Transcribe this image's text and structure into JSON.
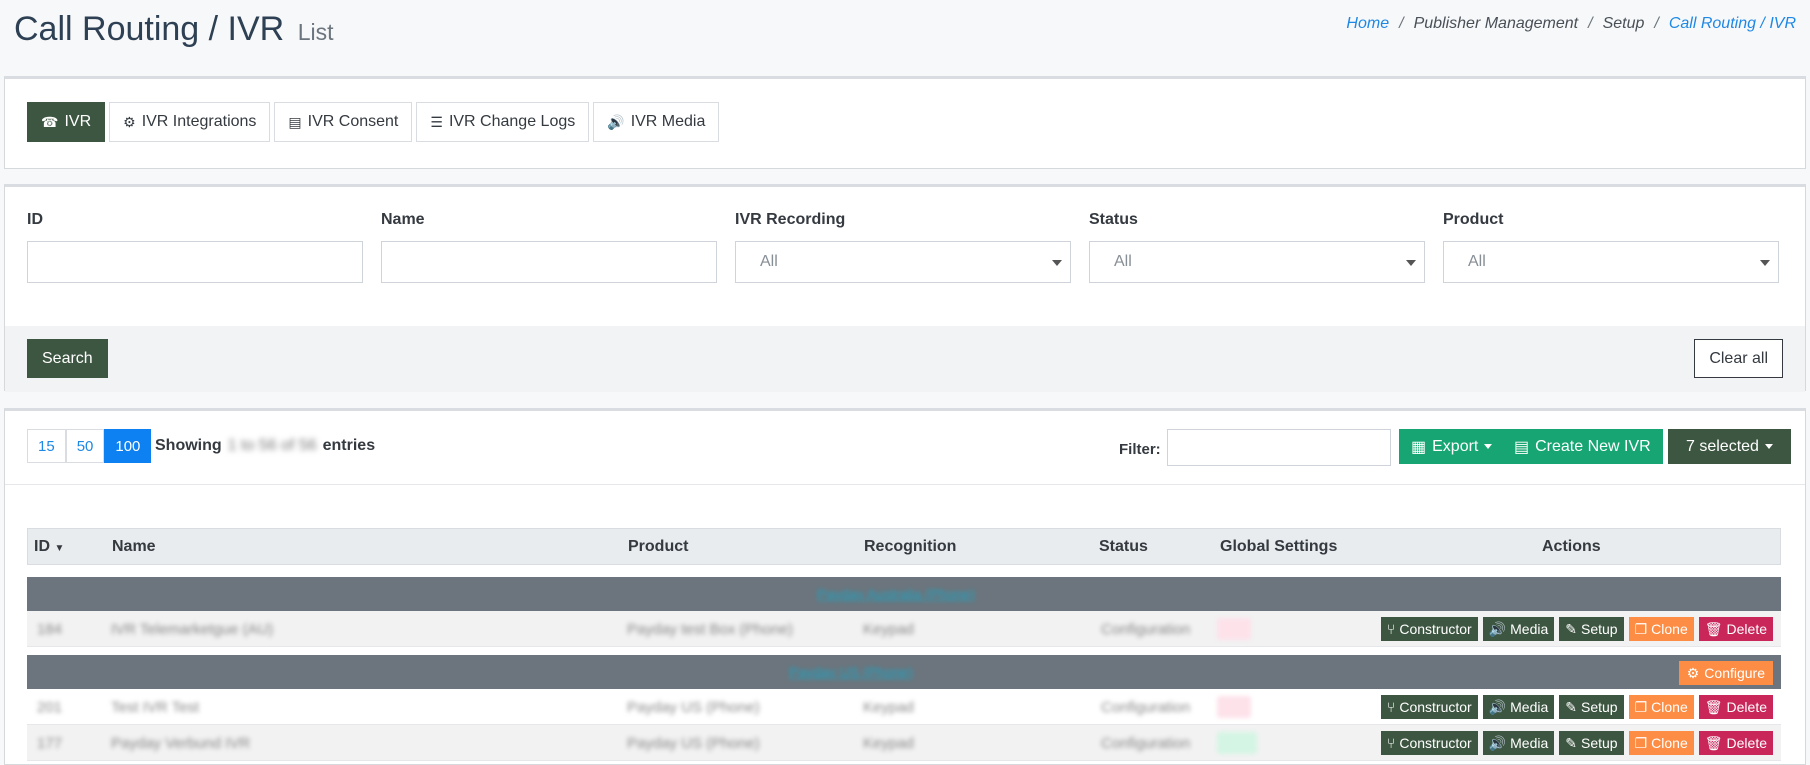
{
  "header": {
    "title": "Call Routing / IVR",
    "subtitle": "List",
    "breadcrumb": [
      "Home",
      "Publisher Management",
      "Setup",
      "Call Routing / IVR"
    ]
  },
  "tabs": [
    {
      "label": "IVR",
      "icon": "phone-square-icon"
    },
    {
      "label": "IVR Integrations",
      "icon": "cogs-icon"
    },
    {
      "label": "IVR Consent",
      "icon": "file-text-icon"
    },
    {
      "label": "IVR Change Logs",
      "icon": "list-icon"
    },
    {
      "label": "IVR Media",
      "icon": "volume-icon"
    }
  ],
  "filters": {
    "id_label": "ID",
    "name_label": "Name",
    "recording_label": "IVR Recording",
    "recording_value": "All",
    "status_label": "Status",
    "status_value": "All",
    "product_label": "Product",
    "product_value": "All",
    "search_button": "Search",
    "clear_button": "Clear all"
  },
  "list": {
    "page_sizes": [
      "15",
      "50",
      "100"
    ],
    "active_page_size": "100",
    "showing_prefix": "Showing",
    "showing_range": "1 to 56 of 56",
    "showing_suffix": "entries",
    "filter_label": "Filter:",
    "export_button": "Export",
    "create_button": "Create New IVR",
    "selected_button": "7 selected"
  },
  "table": {
    "columns": [
      "ID",
      "Name",
      "Product",
      "Recognition",
      "Status",
      "Global Settings",
      "Actions"
    ],
    "group_1": "Payday Australia (Phone)",
    "group_2": "Payday US (Phone)",
    "configure_label": "Configure",
    "action_labels": {
      "constructor": "Constructor",
      "media": "Media",
      "setup": "Setup",
      "clone": "Clone",
      "delete": "Delete"
    },
    "rows": [
      {
        "id": "184",
        "name": "IVR Telemarketgue (AU)",
        "product": "Payday test Box (Phone)",
        "recognition": "Keypad",
        "status": "Configuration",
        "global": "0%"
      },
      {
        "id": "201",
        "name": "Test IVR Test",
        "product": "Payday US (Phone)",
        "recognition": "Keypad",
        "status": "Configuration",
        "global": "0%"
      },
      {
        "id": "177",
        "name": "Payday Verbund IVR",
        "product": "Payday US (Phone)",
        "recognition": "Keypad",
        "status": "Configuration",
        "global": "100%"
      }
    ]
  },
  "colors": {
    "primary_dark": "#3d5641",
    "accent_green": "#17a673",
    "link_blue": "#1e88e5",
    "orange": "#fd8d44",
    "red": "#c9265a"
  }
}
